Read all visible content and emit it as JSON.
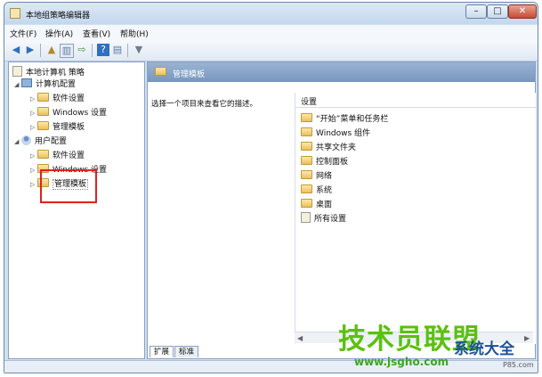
{
  "window": {
    "title": "本地组策略编辑器",
    "min": "–",
    "max": "□",
    "close": "✕"
  },
  "menu": [
    "文件(F)",
    "操作(A)",
    "查看(V)",
    "帮助(H)"
  ],
  "tree": {
    "root": "本地计算机 策略",
    "computer": "计算机配置",
    "computer_children": [
      "软件设置",
      "Windows 设置",
      "管理模板"
    ],
    "user": "用户配置",
    "user_children": [
      "软件设置",
      "Windows 设置",
      "管理模板"
    ]
  },
  "right": {
    "header": "管理模板",
    "description": "选择一个项目来查看它的描述。",
    "list_header": "设置",
    "items": [
      "“开始”菜单和任务栏",
      "Windows 组件",
      "共享文件夹",
      "控制面板",
      "网络",
      "系统",
      "桌面",
      "所有设置"
    ]
  },
  "tabs": [
    "扩展",
    "标准"
  ],
  "watermark": {
    "line1": "技术员联盟",
    "line2": "系统大全",
    "url": "www.jsgho.com",
    "small": "P85.com"
  }
}
